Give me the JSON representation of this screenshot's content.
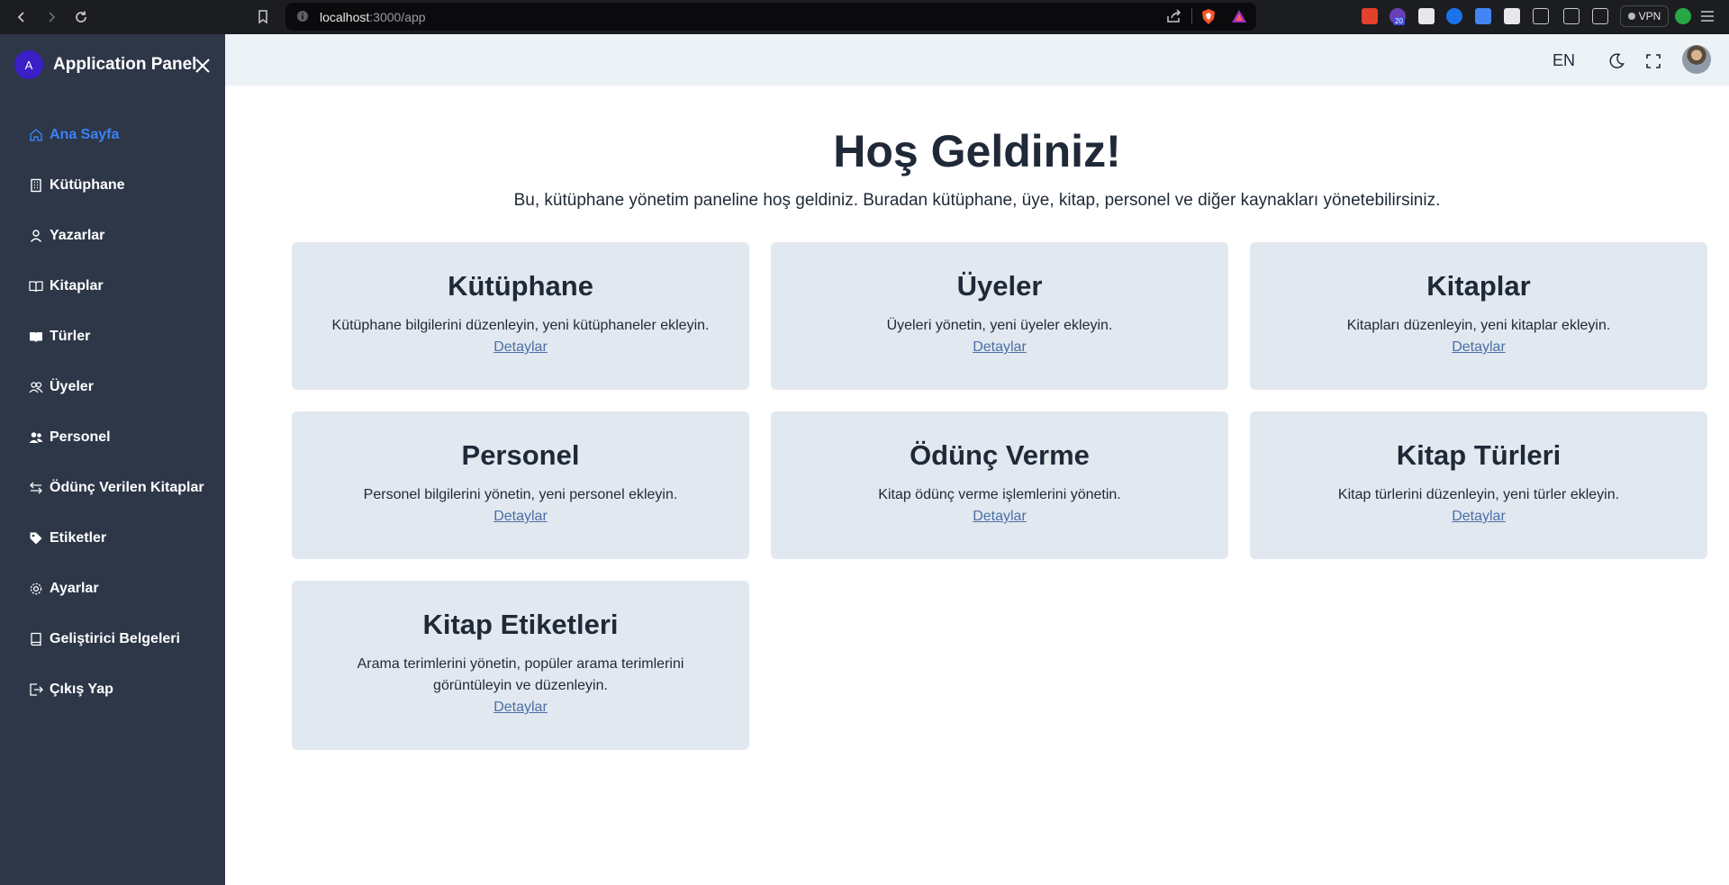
{
  "browser": {
    "url_host": "localhost",
    "url_rest": ":3000/app",
    "vpn_label": "VPN",
    "ext_badge": "20"
  },
  "sidebar": {
    "avatar_letter": "A",
    "title": "Application Panel",
    "items": [
      {
        "label": "Ana Sayfa",
        "icon": "home-icon",
        "active": true
      },
      {
        "label": "Kütüphane",
        "icon": "building-icon"
      },
      {
        "label": "Yazarlar",
        "icon": "user-icon"
      },
      {
        "label": "Kitaplar",
        "icon": "book-open-icon"
      },
      {
        "label": "Türler",
        "icon": "book-icon"
      },
      {
        "label": "Üyeler",
        "icon": "users-icon"
      },
      {
        "label": "Personel",
        "icon": "people-icon"
      },
      {
        "label": "Ödünç Verilen Kitaplar",
        "icon": "arrows-swap-icon"
      },
      {
        "label": "Etiketler",
        "icon": "tag-icon"
      },
      {
        "label": "Ayarlar",
        "icon": "gear-icon"
      },
      {
        "label": "Geliştirici Belgeleri",
        "icon": "doc-book-icon"
      },
      {
        "label": "Çıkış Yap",
        "icon": "logout-icon"
      }
    ]
  },
  "topbar": {
    "language": "EN"
  },
  "main": {
    "title": "Hoş Geldiniz!",
    "subtitle": "Bu, kütüphane yönetim paneline hoş geldiniz. Buradan kütüphane, üye, kitap, personel ve diğer kaynakları yönetebilirsiniz.",
    "cards": [
      {
        "title": "Kütüphane",
        "desc": "Kütüphane bilgilerini düzenleyin, yeni kütüphaneler ekleyin.",
        "link": "Detaylar"
      },
      {
        "title": "Üyeler",
        "desc": "Üyeleri yönetin, yeni üyeler ekleyin.",
        "link": "Detaylar"
      },
      {
        "title": "Kitaplar",
        "desc": "Kitapları düzenleyin, yeni kitaplar ekleyin.",
        "link": "Detaylar"
      },
      {
        "title": "Personel",
        "desc": "Personel bilgilerini yönetin, yeni personel ekleyin.",
        "link": "Detaylar"
      },
      {
        "title": "Ödünç Verme",
        "desc": "Kitap ödünç verme işlemlerini yönetin.",
        "link": "Detaylar"
      },
      {
        "title": "Kitap Türleri",
        "desc": "Kitap türlerini düzenleyin, yeni türler ekleyin.",
        "link": "Detaylar"
      },
      {
        "title": "Kitap Etiketleri",
        "desc": "Arama terimlerini yönetin, popüler arama terimlerini görüntüleyin ve düzenleyin.",
        "link": "Detaylar"
      }
    ]
  }
}
